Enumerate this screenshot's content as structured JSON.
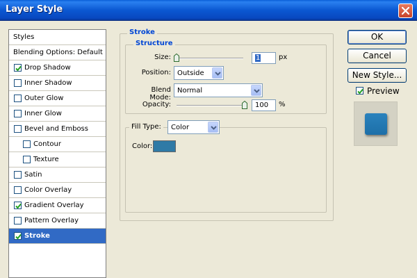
{
  "window": {
    "title": "Layer Style"
  },
  "styles_list": {
    "header": "Styles",
    "blending_options": "Blending Options: Default",
    "items": [
      {
        "label": "Drop Shadow",
        "checked": true,
        "indent": false,
        "selected": false
      },
      {
        "label": "Inner Shadow",
        "checked": false,
        "indent": false,
        "selected": false
      },
      {
        "label": "Outer Glow",
        "checked": false,
        "indent": false,
        "selected": false
      },
      {
        "label": "Inner Glow",
        "checked": false,
        "indent": false,
        "selected": false
      },
      {
        "label": "Bevel and Emboss",
        "checked": false,
        "indent": false,
        "selected": false
      },
      {
        "label": "Contour",
        "checked": false,
        "indent": true,
        "selected": false
      },
      {
        "label": "Texture",
        "checked": false,
        "indent": true,
        "selected": false
      },
      {
        "label": "Satin",
        "checked": false,
        "indent": false,
        "selected": false
      },
      {
        "label": "Color Overlay",
        "checked": false,
        "indent": false,
        "selected": false
      },
      {
        "label": "Gradient Overlay",
        "checked": true,
        "indent": false,
        "selected": false
      },
      {
        "label": "Pattern Overlay",
        "checked": false,
        "indent": false,
        "selected": false
      },
      {
        "label": "Stroke",
        "checked": true,
        "indent": false,
        "selected": true
      }
    ]
  },
  "stroke": {
    "title": "Stroke",
    "structure_title": "Structure",
    "size_label": "Size:",
    "size_value": "1",
    "size_unit": "px",
    "position_label": "Position:",
    "position_value": "Outside",
    "blend_mode_label": "Blend Mode:",
    "blend_mode_value": "Normal",
    "opacity_label": "Opacity:",
    "opacity_value": "100",
    "opacity_unit": "%",
    "fill_type_label": "Fill Type:",
    "fill_type_value": "Color",
    "color_label": "Color:",
    "color_swatch": "#2f7aa6"
  },
  "buttons": {
    "ok": "OK",
    "cancel": "Cancel",
    "new_style": "New Style...",
    "preview_label": "Preview",
    "preview_checked": true,
    "preview_color": "#2a82bd"
  },
  "colors": {
    "titlebar": "#0b58d2",
    "selection": "#316ac5",
    "legend": "#0046d5"
  }
}
